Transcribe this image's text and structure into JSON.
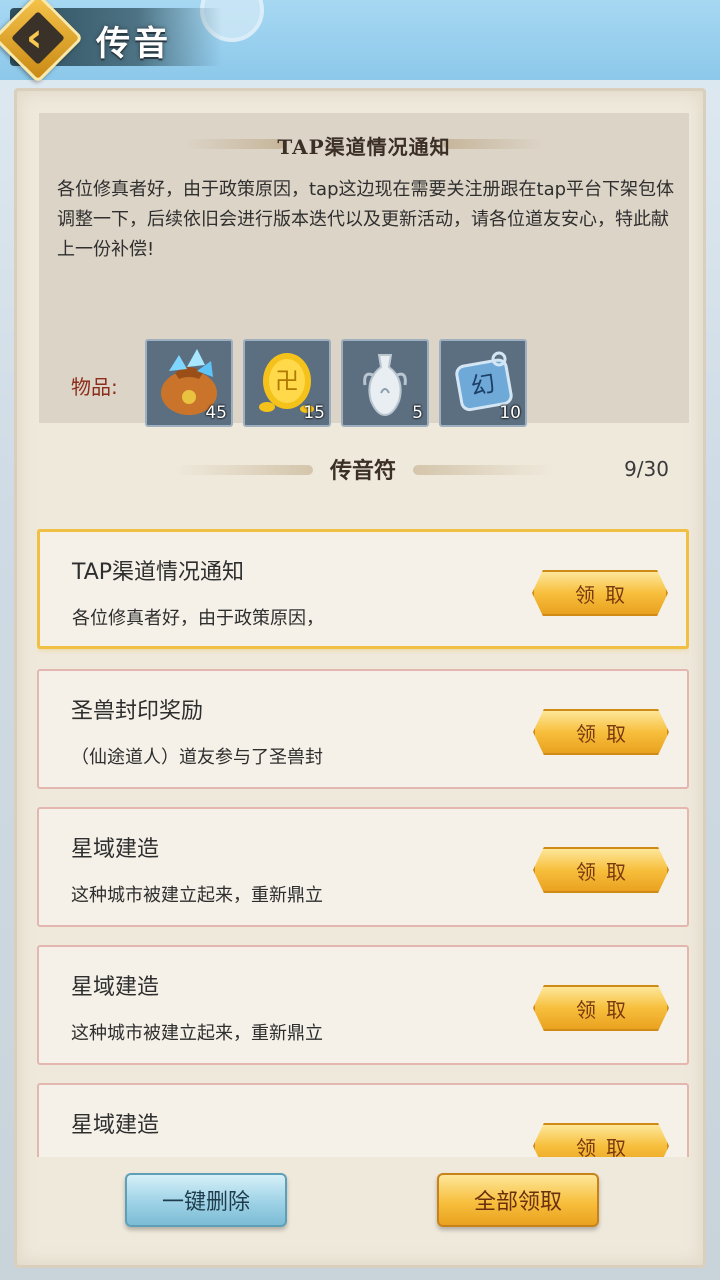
{
  "header": {
    "title": "传音"
  },
  "notice": {
    "title": "TAP渠道情况通知",
    "body": "各位修真者好，由于政策原因，tap这边现在需要关注册跟在tap平台下架包体调整一下，后续依旧会进行版本迭代以及更新活动，请各位道友安心，特此献上一份补偿!",
    "items_label": "物品:",
    "items": [
      {
        "icon": "spirit-stone-bag-icon",
        "count": "45"
      },
      {
        "icon": "gold-coin-icon",
        "count": "15"
      },
      {
        "icon": "porcelain-vase-icon",
        "count": "5"
      },
      {
        "icon": "illusion-token-icon",
        "count": "10"
      }
    ]
  },
  "section": {
    "title": "传音符",
    "count": "9/30"
  },
  "mails": [
    {
      "title": "TAP渠道情况通知",
      "preview": "各位修真者好，由于政策原因，",
      "claim_label": "领取"
    },
    {
      "title": "圣兽封印奖励",
      "preview": "（仙途道人）道友参与了圣兽封",
      "claim_label": "领取"
    },
    {
      "title": "星域建造",
      "preview": "这种城市被建立起来，重新鼎立",
      "claim_label": "领取"
    },
    {
      "title": "星域建造",
      "preview": "这种城市被建立起来，重新鼎立",
      "claim_label": "领取"
    },
    {
      "title": "星域建造",
      "preview": "",
      "claim_label": "领取"
    }
  ],
  "footer": {
    "delete_all_label": "一键删除",
    "claim_all_label": "全部领取"
  },
  "colors": {
    "accent_gold": "#f7bf3d",
    "header_blue": "#8cc8ea",
    "items_label": "#8b2d1a",
    "selected_border": "#f0c044"
  }
}
